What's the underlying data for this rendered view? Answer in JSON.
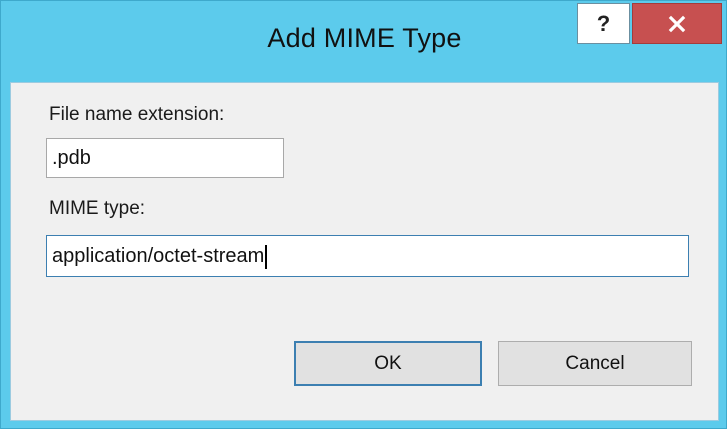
{
  "dialog": {
    "title": "Add MIME Type",
    "help_symbol": "?",
    "close_icon": "close-x-icon"
  },
  "form": {
    "extension_label": "File name extension:",
    "extension_value": ".pdb",
    "mime_label": "MIME type:",
    "mime_value": "application/octet-stream"
  },
  "buttons": {
    "ok_label": "OK",
    "cancel_label": "Cancel"
  },
  "colors": {
    "frame": "#5ccbec",
    "close": "#c75050",
    "client": "#f0f0f0"
  }
}
